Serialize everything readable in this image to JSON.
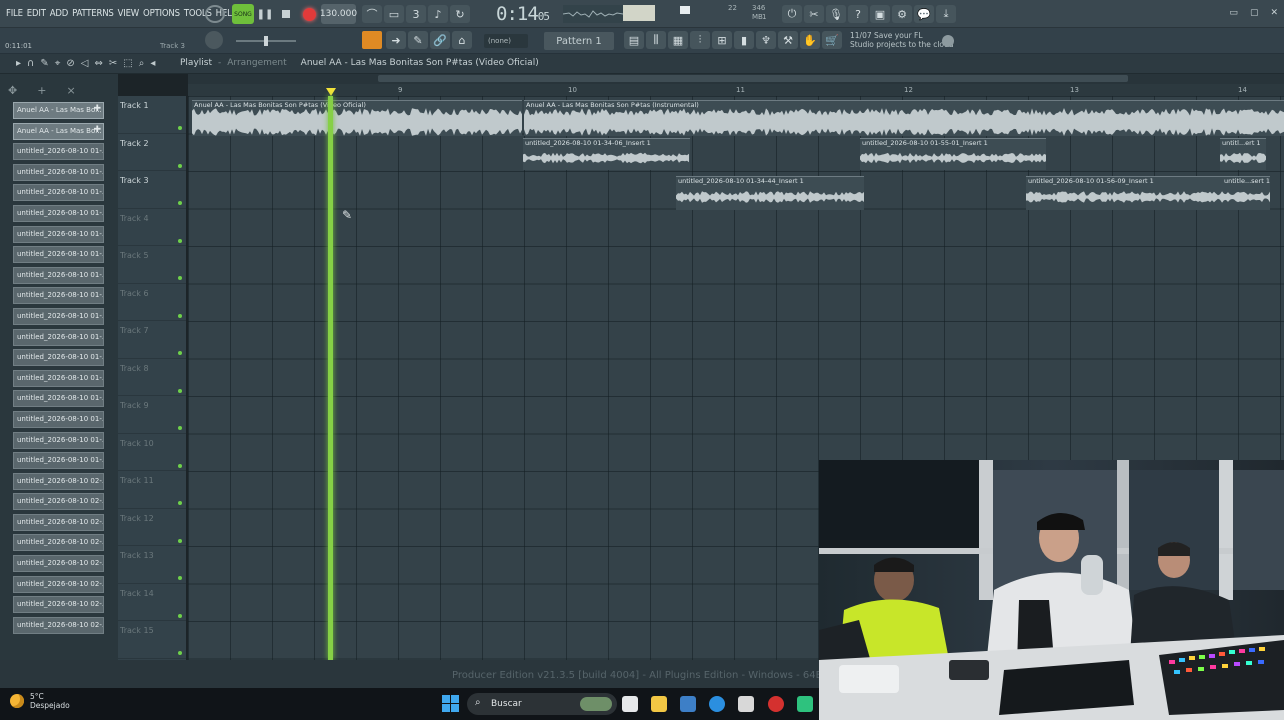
{
  "menu": [
    "FILE",
    "EDIT",
    "ADD",
    "PATTERNS",
    "VIEW",
    "OPTIONS",
    "TOOLS",
    "HELP"
  ],
  "transport": {
    "play_label": "SONG",
    "tempo": "130.000",
    "time_main": "0:14",
    "time_sub": "05"
  },
  "cpu": {
    "mem": "346 MB",
    "line1": "22",
    "line2": "1"
  },
  "hint": {
    "left": "0:11:01",
    "right": "Track 3"
  },
  "pattern": {
    "label": "Pattern 1",
    "none": "(none)"
  },
  "cloud": {
    "line1": "11/07 Save your FL",
    "line2": "Studio projects to the cloud"
  },
  "playlist": {
    "title": "Playlist",
    "sub": "Arrangement",
    "song": "Anuel AA - Las Mas Bonitas Son P#tas (Video Oficial)"
  },
  "browser_clips": [
    "Anuel AA - Las Mas Bo...",
    "Anuel AA - Las Mas Bo...",
    "untitled_2026-08-10 01-...",
    "untitled_2026-08-10 01-...",
    "untitled_2026-08-10 01-...",
    "untitled_2026-08-10 01-...",
    "untitled_2026-08-10 01-...",
    "untitled_2026-08-10 01-...",
    "untitled_2026-08-10 01-...",
    "untitled_2026-08-10 01-...",
    "untitled_2026-08-10 01-...",
    "untitled_2026-08-10 01-...",
    "untitled_2026-08-10 01-...",
    "untitled_2026-08-10 01-...",
    "untitled_2026-08-10 01-...",
    "untitled_2026-08-10 01-...",
    "untitled_2026-08-10 01-...",
    "untitled_2026-08-10 01-...",
    "untitled_2026-08-10 02-...",
    "untitled_2026-08-10 02-...",
    "untitled_2026-08-10 02-...",
    "untitled_2026-08-10 02-...",
    "untitled_2026-08-10 02-...",
    "untitled_2026-08-10 02-...",
    "untitled_2026-08-10 02-...",
    "untitled_2026-08-10 02-..."
  ],
  "tracks": [
    "Track 1",
    "Track 2",
    "Track 3",
    "Track 4",
    "Track 5",
    "Track 6",
    "Track 7",
    "Track 8",
    "Track 9",
    "Track 10",
    "Track 11",
    "Track 12",
    "Track 13",
    "Track 14",
    "Track 15"
  ],
  "ruler": [
    "9",
    "10",
    "11",
    "12",
    "13",
    "14"
  ],
  "audio_clips": [
    {
      "label": "Anuel AA - Las Mas Bonitas Son P#tas (Video Oficial)",
      "track": 1
    },
    {
      "label": "Anuel AA - Las Mas Bonitas Son P#tas (Instrumental)",
      "track": 1
    },
    {
      "label": "untitled_2026-08-10 01-34-06_Insert 1",
      "track": 2
    },
    {
      "label": "untitled_2026-08-10 01-55-01_Insert 1",
      "track": 2
    },
    {
      "label": "untitl...ert 1",
      "track": 2
    },
    {
      "label": "untitled_2026-08-10 01-34-44_Insert 1",
      "track": 3
    },
    {
      "label": "untitled_2026-08-10 01-56-09_Insert 1",
      "track": 3
    },
    {
      "label": "untitle...sert 1",
      "track": 3
    }
  ],
  "status_text": "Producer Edition v21.3.5 [build 4004] - All Plugins Edition - Windows - 64Bit",
  "taskbar": {
    "temp": "5°C",
    "weather": "Despejado",
    "search": "Buscar"
  },
  "colors": {
    "playhead": "#86d046",
    "record": "#e33a3a",
    "accent": "#e08a24"
  }
}
